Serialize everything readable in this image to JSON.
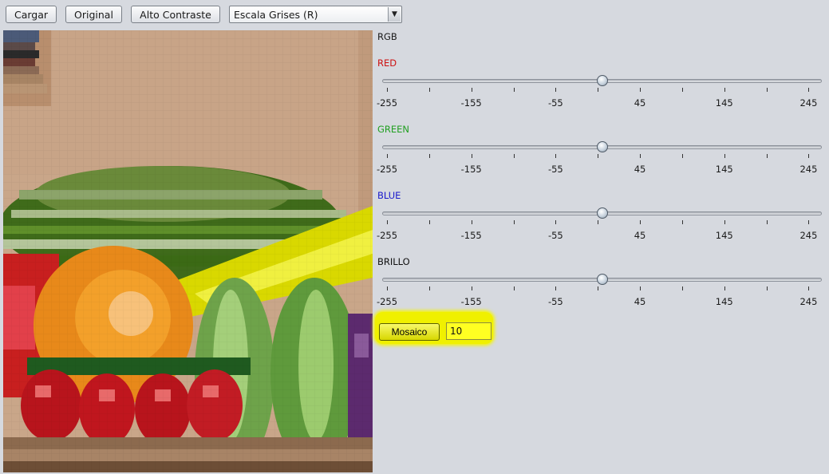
{
  "toolbar": {
    "load_label": "Cargar",
    "original_label": "Original",
    "contrast_label": "Alto Contraste",
    "filter_select_value": "Escala Grises (R)"
  },
  "controls": {
    "rgb_label": "RGB",
    "sliders": [
      {
        "label": "RED",
        "color": "#cc1111",
        "value": 0
      },
      {
        "label": "GREEN",
        "color": "#22a022",
        "value": 0
      },
      {
        "label": "BLUE",
        "color": "#1a1acc",
        "value": 0
      },
      {
        "label": "BRILLO",
        "color": "#111111",
        "value": 0
      }
    ],
    "scale": {
      "min": -255,
      "max": 255,
      "labels": [
        "-255",
        "-155",
        "-55",
        "45",
        "145",
        "245"
      ]
    },
    "mosaic": {
      "button_label": "Mosaico",
      "input_value": "10",
      "highlight_color": "#f0f000"
    }
  },
  "image": {
    "description_icon": "pixelated-fruit-bowl-image"
  }
}
